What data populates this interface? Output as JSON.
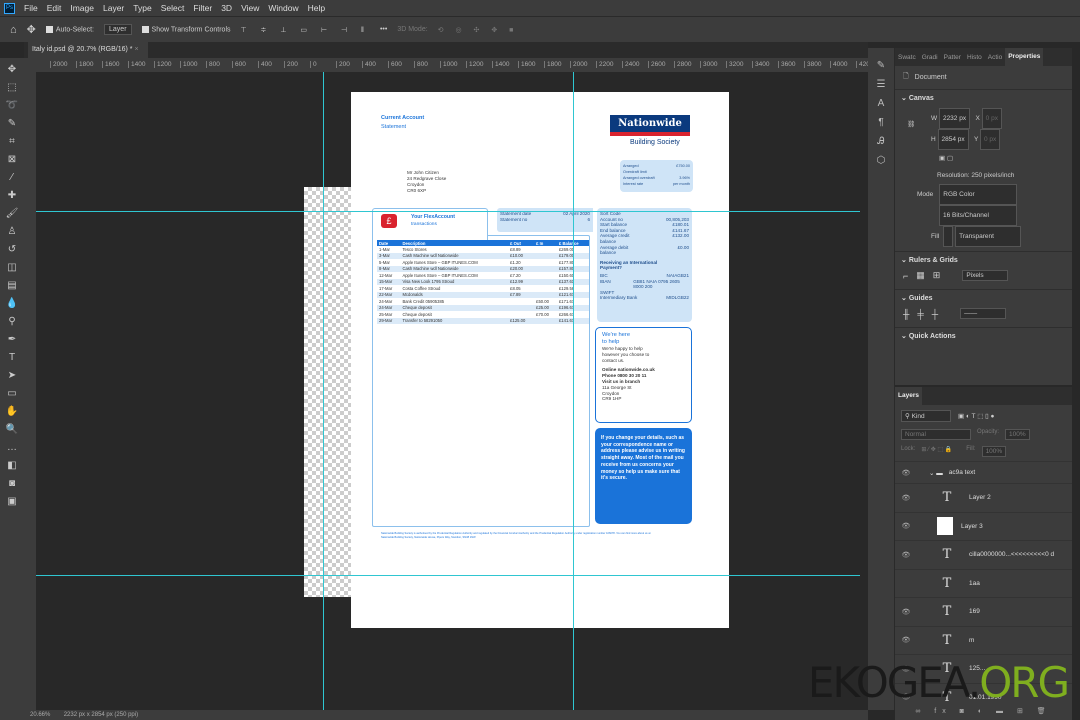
{
  "menu": {
    "items": [
      "File",
      "Edit",
      "Image",
      "Layer",
      "Type",
      "Select",
      "Filter",
      "3D",
      "View",
      "Window",
      "Help"
    ]
  },
  "options": {
    "auto_select": "Auto-Select:",
    "layer_select": "Layer",
    "show_transform": "Show Transform Controls",
    "mode_3d": "3D Mode:"
  },
  "doc_tab": {
    "title": "Italy id.psd @ 20.7% (RGB/16) *",
    "close": "×"
  },
  "ruler": {
    "labels": [
      "2000",
      "1800",
      "1600",
      "1400",
      "1200",
      "1000",
      "800",
      "600",
      "400",
      "200",
      "0",
      "200",
      "400",
      "600",
      "800",
      "1000",
      "1200",
      "1400",
      "1600",
      "1800",
      "2000",
      "2200",
      "2400",
      "2600",
      "2800",
      "3000",
      "3200",
      "3400",
      "3600",
      "3800",
      "4000",
      "4200"
    ]
  },
  "document": {
    "title1": "Current Account",
    "title2": "Statement",
    "logo": "Nationwide",
    "logo_sub": "Building Society",
    "summary": [
      [
        "Arranged",
        "£750.00"
      ],
      [
        "Overdraft limit",
        ""
      ],
      [
        "Arranged overdraft",
        "3.96%"
      ],
      [
        "Interest rate",
        "per month"
      ]
    ],
    "address": [
      "Mr John Citizen",
      "24 Redgrave Close",
      "Croydon",
      "CR0 6XP"
    ],
    "flex_title": "Your FlexAccount",
    "flex_sub": "transactions",
    "stmt": [
      [
        "Statement date",
        "02 April 2020"
      ],
      [
        "Statement no",
        "6"
      ]
    ],
    "account": [
      [
        "Sort Code",
        ""
      ],
      [
        "Account no",
        "00,805,203"
      ],
      [
        "Start balance",
        "£180.01"
      ],
      [
        "End balance",
        "£141.67"
      ],
      [
        "Average credit balance",
        "£132.00"
      ],
      [
        "Average debit balance",
        "£0.00"
      ]
    ],
    "intl_title": "Receiving an International Payment?",
    "intl": [
      [
        "BIC",
        "NAIAGB21"
      ],
      [
        "IBAN",
        "GB81 NAIA 0795 2605 8000 200"
      ],
      [
        "SWIFT",
        ""
      ],
      [
        "Intermediary Bank",
        "MIDLGB22"
      ]
    ],
    "table": {
      "headers": [
        "Date",
        "Description",
        "£ Out",
        "£ In",
        "£ Balance"
      ],
      "rows": [
        [
          "1-Mar",
          "Tesco Stores",
          "£8.89",
          "",
          "£269.00"
        ],
        [
          "3-Mar",
          "Cash Machine wdl Nationwide",
          "£10.00",
          "",
          "£179.00"
        ],
        [
          "5-Mar",
          "Apple Itunes Store – GBP ITUNES.COM",
          "£1.20",
          "",
          "£177.80"
        ],
        [
          "8-Mar",
          "Cash Machine wdl Nationwide",
          "£20.00",
          "",
          "£157.80"
        ],
        [
          "12-Mar",
          "Apple Itunes Store – GBP ITUNES.COM",
          "£7.20",
          "",
          "£150.60"
        ],
        [
          "15-Mar",
          "Visa New Look 1795 Stroud",
          "£12.99",
          "",
          "£137.61"
        ],
        [
          "17-Mar",
          "Costa Coffee Stroud",
          "£8.05",
          "",
          "£129.56"
        ],
        [
          "22-Mar",
          "Mcdonalds",
          "£7.89",
          "",
          "£121.67"
        ],
        [
          "24-Mar",
          "Bank Credit 05905385",
          "",
          "£50.00",
          "£171.67"
        ],
        [
          "24-Mar",
          "Cheque deposit",
          "",
          "£25.00",
          "£196.67"
        ],
        [
          "25-Mar",
          "Cheque deposit",
          "",
          "£70.00",
          "£266.67"
        ],
        [
          "29-Mar",
          "Transfer to 58291050",
          "£125.00",
          "",
          "£141.67"
        ]
      ]
    },
    "help": {
      "title1": "We're here",
      "title2": "to help",
      "text": "We're happy to help however you choose to contact us.",
      "online": "Online nationwide.co.uk",
      "phone": "Phone 0800 30 20 11",
      "visit": "Visit us in branch",
      "branch": [
        "11a George St",
        "Croydon",
        "CR9 1HP"
      ]
    },
    "notice": "If you change your details, such as your correspondence name or address please advise us in writing straight away. Most of the mail you receive from us concerns your money so help us make sure that it's secure.",
    "footer": "Nationwide Building Society is authorised by the Prudential Regulation Authority and regulated by the Financial Conduct Authority and the Prudential Regulation Authority under registration number 106078. You can find more about us at Nationwide Building Society, Nationwide House, Pipers Way, Swindon, SN38 1NW"
  },
  "properties": {
    "tabs": [
      "Swatc",
      "Gradi",
      "Patter",
      "Histo",
      "Actio",
      "Properties"
    ],
    "document": "Document",
    "canvas": "Canvas",
    "w_label": "W",
    "w": "2232 px",
    "h_label": "H",
    "h": "2854 px",
    "x_label": "X",
    "x": "0 px",
    "y_label": "Y",
    "y": "0 px",
    "resolution": "Resolution: 250 pixels/inch",
    "mode_label": "Mode",
    "mode": "RGB Color",
    "depth": "16 Bits/Channel",
    "fill_label": "Fill",
    "fill": "Transparent",
    "rulers": "Rulers & Grids",
    "units": "Pixels",
    "guides": "Guides",
    "quick": "Quick Actions"
  },
  "layers": {
    "tab": "Layers",
    "kind": "Kind",
    "blend": "Normal",
    "opacity_label": "Opacity:",
    "opacity": "100%",
    "lock": "Lock:",
    "fill_label": "Fill:",
    "fill": "100%",
    "items": [
      {
        "name": "ac9a text",
        "type": "group"
      },
      {
        "name": "Layer 2",
        "type": "text"
      },
      {
        "name": "Layer 3",
        "type": "image"
      },
      {
        "name": "cilla0000000...<<<<<<<<<0 d",
        "type": "text"
      },
      {
        "name": "1aa",
        "type": "text"
      },
      {
        "name": "169",
        "type": "text"
      },
      {
        "name": "m",
        "type": "text"
      },
      {
        "name": "125...",
        "type": "text"
      },
      {
        "name": "01.01.1990",
        "type": "text"
      }
    ]
  },
  "status": {
    "zoom": "20.66%",
    "size": "2232 px x 2854 px (250 ppi)"
  },
  "watermark": {
    "a": "EKOGEA.",
    "b": "ORG"
  },
  "colors": {
    "accent": "#1a73d9",
    "guide": "#2fc6d1",
    "brand": "#0b3a7e",
    "red": "#d9232e"
  }
}
